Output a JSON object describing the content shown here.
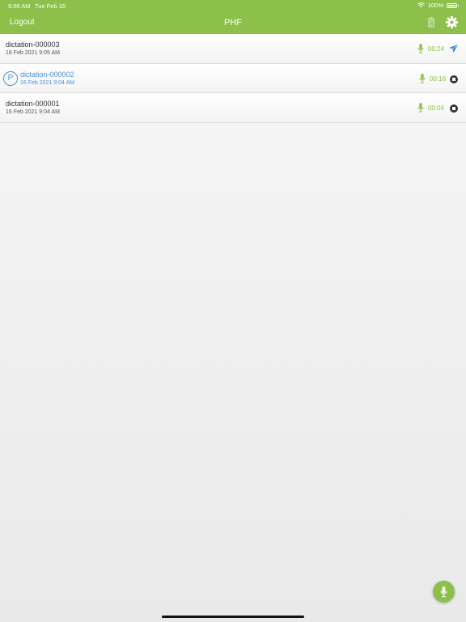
{
  "status_bar": {
    "time": "9:06 AM",
    "date": "Tue Feb 16",
    "battery": "100%",
    "battery_level": 1.0
  },
  "header": {
    "logout_label": "Logout",
    "title": "PHF",
    "icons": [
      "trash-icon",
      "gear-icon"
    ]
  },
  "dictations": [
    {
      "title": "dictation-000003",
      "date": "16 Feb 2021 9:05 AM",
      "duration": "00:24",
      "action_icon": "send-icon",
      "pending": false
    },
    {
      "badge": "P",
      "title": "dictation-000002",
      "date": "16 Feb 2021 9:04 AM",
      "duration": "00:16",
      "action_icon": "stop-icon",
      "pending": true
    },
    {
      "title": "dictation-000001",
      "date": "16 Feb 2021 9:04 AM",
      "duration": "00:04",
      "action_icon": "stop-icon",
      "pending": false
    }
  ],
  "colors": {
    "accent": "#8dc04a",
    "pending": "#4a90d9",
    "text": "#333333"
  },
  "fab_icon": "microphone-icon"
}
